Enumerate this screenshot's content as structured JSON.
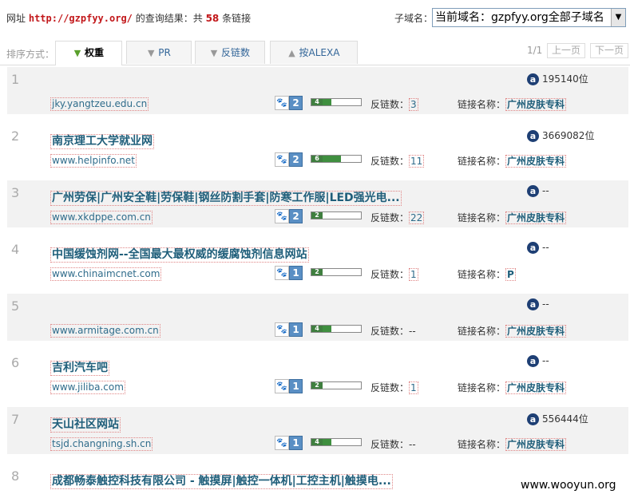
{
  "header": {
    "prefix": "网址",
    "url": "http://gzpfyy.org/",
    "mid": "的查询结果：共",
    "count": "58",
    "suffix": "条链接",
    "subdomain_label": "子域名：",
    "subdomain_value": "当前域名：gzpfyy.org全部子域名"
  },
  "sort": {
    "label": "排序方式：",
    "tabs": [
      {
        "label": "权重",
        "icon": "arrow-down-icon",
        "active": true
      },
      {
        "label": "PR",
        "icon": "arrow-down-icon",
        "active": false
      },
      {
        "label": "反链数",
        "icon": "arrow-down-icon",
        "active": false
      },
      {
        "label": "按ALEXA",
        "icon": "arrow-up-icon",
        "active": false
      }
    ]
  },
  "pager": {
    "status": "1/1",
    "prev": "上一页",
    "next": "下一页"
  },
  "labels": {
    "backlinks": "反链数：",
    "link_name": "链接名称："
  },
  "rows": [
    {
      "idx": "1",
      "title": "",
      "site": "jky.yangtzeu.edu.cn",
      "baidu": "2",
      "pr": "4",
      "pr_level": 0.4,
      "backlinks": "3",
      "link_name": "广州皮肤专科",
      "alexa": "195140位"
    },
    {
      "idx": "2",
      "title": "南京理工大学就业网",
      "site": "www.helpinfo.net",
      "baidu": "2",
      "pr": "6",
      "pr_level": 0.6,
      "backlinks": "11",
      "link_name": "广州皮肤专科",
      "alexa": "3669082位"
    },
    {
      "idx": "3",
      "title": "广州劳保|广州安全鞋|劳保鞋|钢丝防割手套|防寒工作服|LED强光电...",
      "site": "www.xkdppe.com.cn",
      "baidu": "2",
      "pr": "2",
      "pr_level": 0.2,
      "backlinks": "22",
      "link_name": "广州皮肤专科",
      "alexa": "--"
    },
    {
      "idx": "4",
      "title": "中国缓蚀剂网--全国最大最权威的缓腐蚀剂信息网站",
      "site": "www.chinaimcnet.com",
      "baidu": "1",
      "pr": "2",
      "pr_level": 0.2,
      "backlinks": "1",
      "link_name": "P",
      "alexa": "--"
    },
    {
      "idx": "5",
      "title": "",
      "site": "www.armitage.com.cn",
      "baidu": "1",
      "pr": "4",
      "pr_level": 0.4,
      "backlinks": "--",
      "link_name": "广州皮肤专科",
      "alexa": "--"
    },
    {
      "idx": "6",
      "title": "吉利汽车吧",
      "site": "www.jiliba.com",
      "baidu": "1",
      "pr": "2",
      "pr_level": 0.2,
      "backlinks": "1",
      "link_name": "广州皮肤专科",
      "alexa": "--"
    },
    {
      "idx": "7",
      "title": "天山社区网站",
      "site": "tsjd.changning.sh.cn",
      "baidu": "1",
      "pr": "4",
      "pr_level": 0.4,
      "backlinks": "--",
      "link_name": "广州皮肤专科",
      "alexa": "556444位"
    },
    {
      "idx": "8",
      "title": "成都畅泰触控科技有限公司 - 触摸屏|触控一体机|工控主机|触摸电...",
      "site": "",
      "baidu": "",
      "pr": "",
      "pr_level": 0,
      "backlinks": "",
      "link_name": "",
      "alexa": ""
    }
  ],
  "watermark": "www.wooyun.org"
}
